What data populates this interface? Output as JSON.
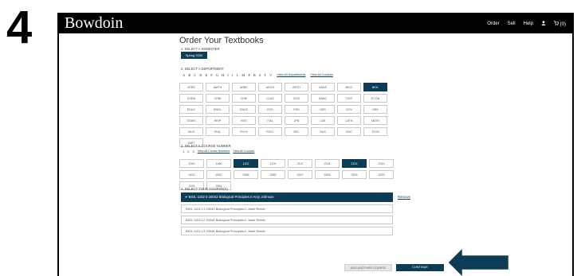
{
  "step_number": "4",
  "header": {
    "brand": "Bowdoin",
    "nav": [
      "Order",
      "Sell",
      "Help"
    ],
    "cart_count": "(0)"
  },
  "page_title": "Order Your Textbooks",
  "semester": {
    "label": "1. SELECT A SEMESTER",
    "selected": "Spring 2020"
  },
  "department": {
    "label": "2. SELECT A DEPARTMENT",
    "letters": [
      "A",
      "B",
      "C",
      "D",
      "E",
      "F",
      "G",
      "H",
      "I",
      "J",
      "L",
      "M",
      "P",
      "R",
      "S",
      "T",
      "V"
    ],
    "view_all_departments": "View All Departments",
    "view_all_courses": "View All Courses",
    "items": [
      "AFRS",
      "AMTH",
      "ARBC",
      "ARCH",
      "ARTH",
      "ASNS",
      "BIOC",
      "BIOL",
      "CHEM",
      "CHIN",
      "CHIE",
      "CLAS",
      "CSCI",
      "DANC",
      "DCS",
      "ECON",
      "EDUC",
      "ENGL",
      "ENVS",
      "EOS",
      "FRS",
      "GER",
      "GOV",
      "GRK",
      "GSWS",
      "HISP",
      "HIST",
      "ITAL",
      "JPN",
      "LAS",
      "LATN",
      "MATH",
      "MUS",
      "PHIL",
      "PHYS",
      "PSYC",
      "REL",
      "RUS",
      "SOC",
      "THTR",
      "VART"
    ],
    "selected": "BIOL"
  },
  "course": {
    "label": "3. SELECT A COURSE NUMBER",
    "pages": [
      "1",
      "2",
      "3"
    ],
    "view_all_numbers": "View All Course Numbers",
    "view_all_courses": "View All Courses",
    "items": [
      "1000",
      "1060",
      "1102",
      "1109",
      "2112",
      "2118",
      "2214",
      "2316",
      "2423",
      "2510",
      "2566",
      "3280",
      "3307",
      "3308",
      "3309",
      "3325",
      "3333",
      "3554"
    ],
    "selected": [
      "1102",
      "2214"
    ]
  },
  "selection": {
    "label": "4. SELECT YOUR COURSE(S)",
    "selected_course": "✔ BIOL 1102 0 20042 Biological Principles II Amy Johnson",
    "remove": "Remove",
    "other_courses": [
      "BIOL 1102 L1 20043 Biological Principles II Janet Reblin",
      "BIOL 1102 L2 20044 Biological Principles II Janet Reblin",
      "BIOL 1102 L3 20045 Biological Principles II Janet Reblin"
    ]
  },
  "buttons": {
    "add_another": "ADD ANOTHER COURSE",
    "continue": "CONTINUE"
  },
  "colors": {
    "accent": "#0c3c56",
    "header": "#000000"
  }
}
